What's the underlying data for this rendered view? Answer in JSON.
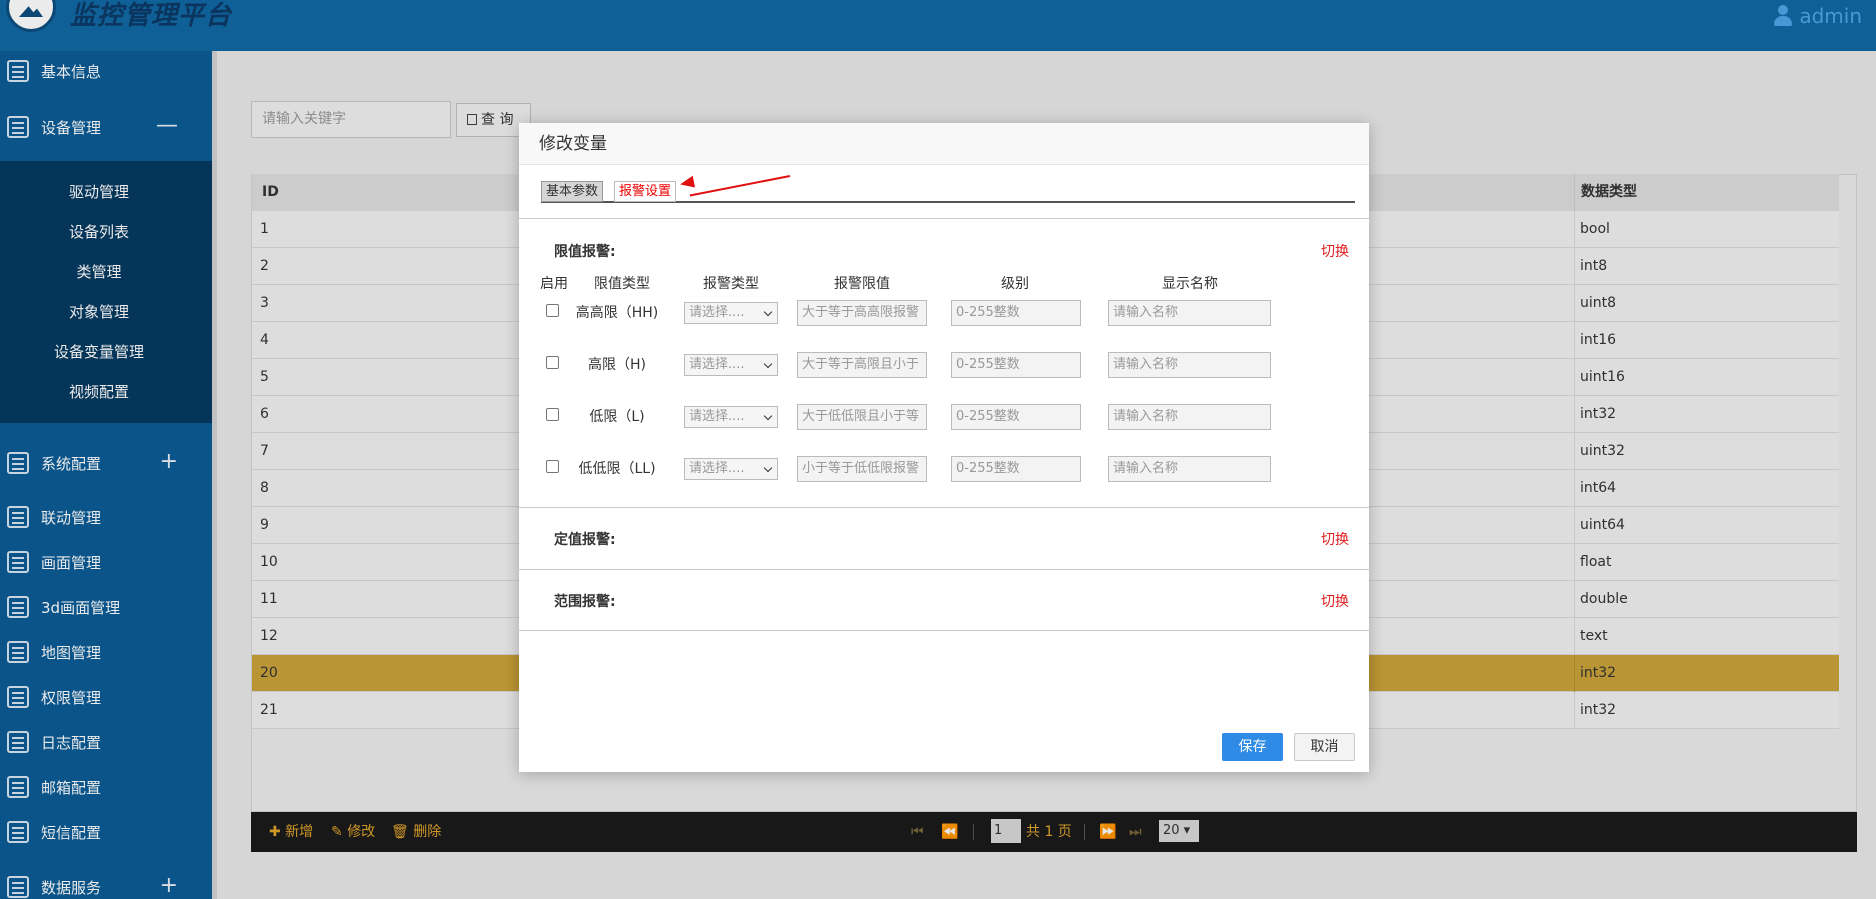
{
  "header": {
    "title": "监控管理平台",
    "user": "admin"
  },
  "sidebar": {
    "items": [
      {
        "label": "基本信息",
        "icon": "document-icon",
        "toggle": ""
      },
      {
        "label": "设备管理",
        "icon": "monitor-icon",
        "toggle": "—"
      },
      {
        "label": "系统配置",
        "icon": "settings-icon",
        "toggle": "+"
      },
      {
        "label": "联动管理",
        "icon": "link-icon",
        "toggle": ""
      },
      {
        "label": "画面管理",
        "icon": "image-icon",
        "toggle": ""
      },
      {
        "label": "3d画面管理",
        "icon": "3d-icon",
        "toggle": ""
      },
      {
        "label": "地图管理",
        "icon": "map-pin-icon",
        "toggle": ""
      },
      {
        "label": "权限管理",
        "icon": "user-icon",
        "toggle": ""
      },
      {
        "label": "日志配置",
        "icon": "log-icon",
        "toggle": ""
      },
      {
        "label": "邮箱配置",
        "icon": "mail-icon",
        "toggle": ""
      },
      {
        "label": "短信配置",
        "icon": "sms-icon",
        "toggle": ""
      },
      {
        "label": "数据服务",
        "icon": "chart-icon",
        "toggle": "+"
      }
    ],
    "submenu": [
      "驱动管理",
      "设备列表",
      "类管理",
      "对象管理",
      "设备变量管理",
      "视频配置"
    ]
  },
  "search": {
    "placeholder": "请输入关键字",
    "button": "查 询"
  },
  "table": {
    "headers": {
      "id": "ID",
      "type": "数据类型"
    },
    "rows": [
      {
        "id": "1",
        "type": "bool"
      },
      {
        "id": "2",
        "type": "int8"
      },
      {
        "id": "3",
        "type": "uint8"
      },
      {
        "id": "4",
        "type": "int16"
      },
      {
        "id": "5",
        "type": "uint16"
      },
      {
        "id": "6",
        "type": "int32"
      },
      {
        "id": "7",
        "type": "uint32"
      },
      {
        "id": "8",
        "type": "int64"
      },
      {
        "id": "9",
        "type": "uint64"
      },
      {
        "id": "10",
        "type": "float"
      },
      {
        "id": "11",
        "type": "double"
      },
      {
        "id": "12",
        "type": "text"
      },
      {
        "id": "20",
        "type": "int32"
      },
      {
        "id": "21",
        "type": "int32"
      }
    ],
    "selected_index": 12
  },
  "footer": {
    "add": "新增",
    "edit": "修改",
    "delete": "删除",
    "page_input": "1",
    "page_total": "共 1 页",
    "page_size": "20"
  },
  "modal": {
    "title": "修改变量",
    "tabs": {
      "basic": "基本参数",
      "alarm": "报警设置"
    },
    "limit_section": {
      "title": "限值报警:",
      "switch": "切换",
      "columns": {
        "enable": "启用",
        "limit_type": "限值类型",
        "alarm_type": "报警类型",
        "limit_value": "报警限值",
        "level": "级别",
        "display_name": "显示名称"
      },
      "rows": [
        {
          "label": "高高限（HH)",
          "select": "请选择....",
          "limit_ph": "大于等于高高限报警",
          "level_ph": "0-255整数",
          "name_ph": "请输入名称"
        },
        {
          "label": "高限（H)",
          "select": "请选择....",
          "limit_ph": "大于等于高限且小于",
          "level_ph": "0-255整数",
          "name_ph": "请输入名称"
        },
        {
          "label": "低限（L)",
          "select": "请选择....",
          "limit_ph": "大于低低限且小于等",
          "level_ph": "0-255整数",
          "name_ph": "请输入名称"
        },
        {
          "label": "低低限（LL)",
          "select": "请选择....",
          "limit_ph": "小于等于低低限报警",
          "level_ph": "0-255整数",
          "name_ph": "请输入名称"
        }
      ]
    },
    "fixed_section": {
      "title": "定值报警:",
      "switch": "切换"
    },
    "range_section": {
      "title": "范围报警:",
      "switch": "切换"
    },
    "save": "保存",
    "cancel": "取消"
  },
  "colors": {
    "header": "#1269a5",
    "sidebar": "#0b5c96",
    "submenu": "#063a61",
    "accent_red": "#e02020",
    "save_blue": "#2f8be6",
    "selected_row": "#c9a23a"
  }
}
